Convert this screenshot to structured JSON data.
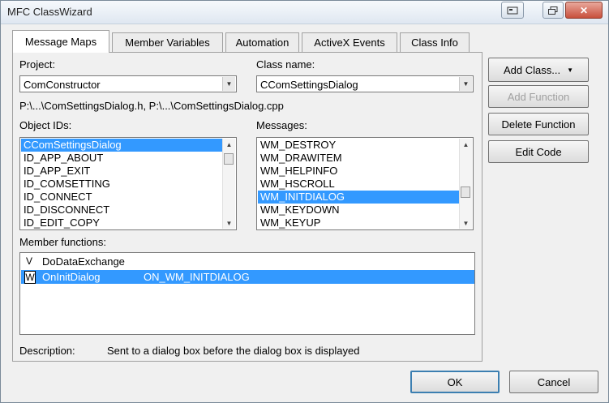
{
  "window": {
    "title": "MFC ClassWizard"
  },
  "titlebar": {
    "help_icon": "help-icon",
    "restore_icon": "restore-icon",
    "close_icon": "close-icon",
    "close_glyph": "✕"
  },
  "tabs": [
    {
      "label": "Message Maps",
      "active": true
    },
    {
      "label": "Member Variables"
    },
    {
      "label": "Automation"
    },
    {
      "label": "ActiveX Events"
    },
    {
      "label": "Class Info"
    }
  ],
  "project": {
    "label": "Project:",
    "value": "ComConstructor"
  },
  "class_name": {
    "label": "Class name:",
    "value": "CComSettingsDialog"
  },
  "paths": "P:\\...\\ComSettingsDialog.h, P:\\...\\ComSettingsDialog.cpp",
  "object_ids": {
    "label": "Object IDs:",
    "items": [
      "CComSettingsDialog",
      "ID_APP_ABOUT",
      "ID_APP_EXIT",
      "ID_COMSETTING",
      "ID_CONNECT",
      "ID_DISCONNECT",
      "ID_EDIT_COPY"
    ],
    "selected_index": 0
  },
  "messages": {
    "label": "Messages:",
    "items": [
      "WM_DESTROY",
      "WM_DRAWITEM",
      "WM_HELPINFO",
      "WM_HSCROLL",
      "WM_INITDIALOG",
      "WM_KEYDOWN",
      "WM_KEYUP"
    ],
    "selected_index": 4
  },
  "member_functions": {
    "label": "Member functions:",
    "rows": [
      {
        "flag": "V",
        "name": "DoDataExchange",
        "message": ""
      },
      {
        "flag": "W",
        "name": "OnInitDialog",
        "message": "ON_WM_INITDIALOG"
      }
    ],
    "selected_index": 1
  },
  "description": {
    "label": "Description:",
    "text": "Sent to a dialog box before the dialog box is displayed"
  },
  "buttons": {
    "add_class": "Add Class...",
    "add_function": "Add Function",
    "delete_function": "Delete Function",
    "edit_code": "Edit Code",
    "ok": "OK",
    "cancel": "Cancel"
  },
  "colors": {
    "selection": "#3399ff",
    "close_button": "#c8503c"
  }
}
